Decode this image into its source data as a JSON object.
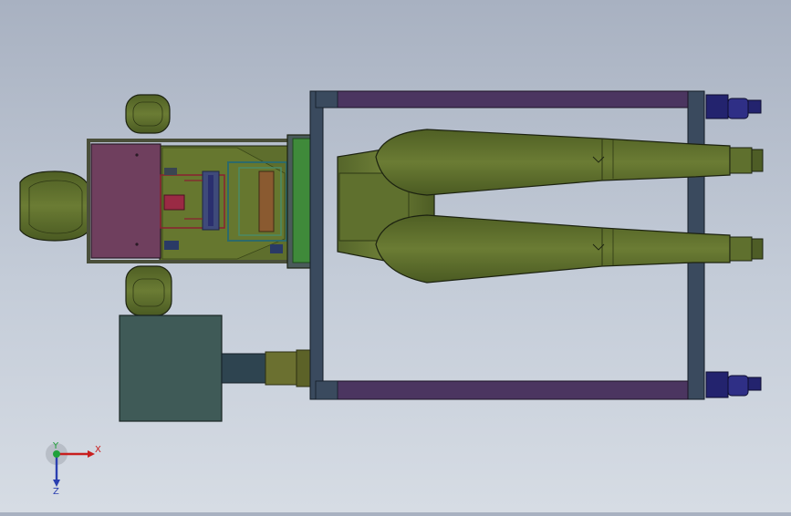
{
  "viewport": {
    "background_top": "#a8b1c1",
    "background_bottom": "#d6dce4"
  },
  "model": {
    "colors": {
      "olive": "#5b6b2c",
      "olive_light": "#73843a",
      "olive_dark": "#3e4a1c",
      "frame_purple": "#4b3560",
      "frame_slate": "#3a4a5e",
      "panel_magenta": "#6f3f5e",
      "block_teal": "#3f5a57",
      "pipe_steel": "#2e4450",
      "green_plate": "#3f8a3a",
      "caster_blue": "#23236e",
      "edge": "#1c2210"
    }
  },
  "triad": {
    "x_label": "X",
    "y_label": "Y",
    "z_label": "Z",
    "x_color": "#c81e1e",
    "y_color": "#1fa13a",
    "z_color": "#2a3fb0"
  }
}
